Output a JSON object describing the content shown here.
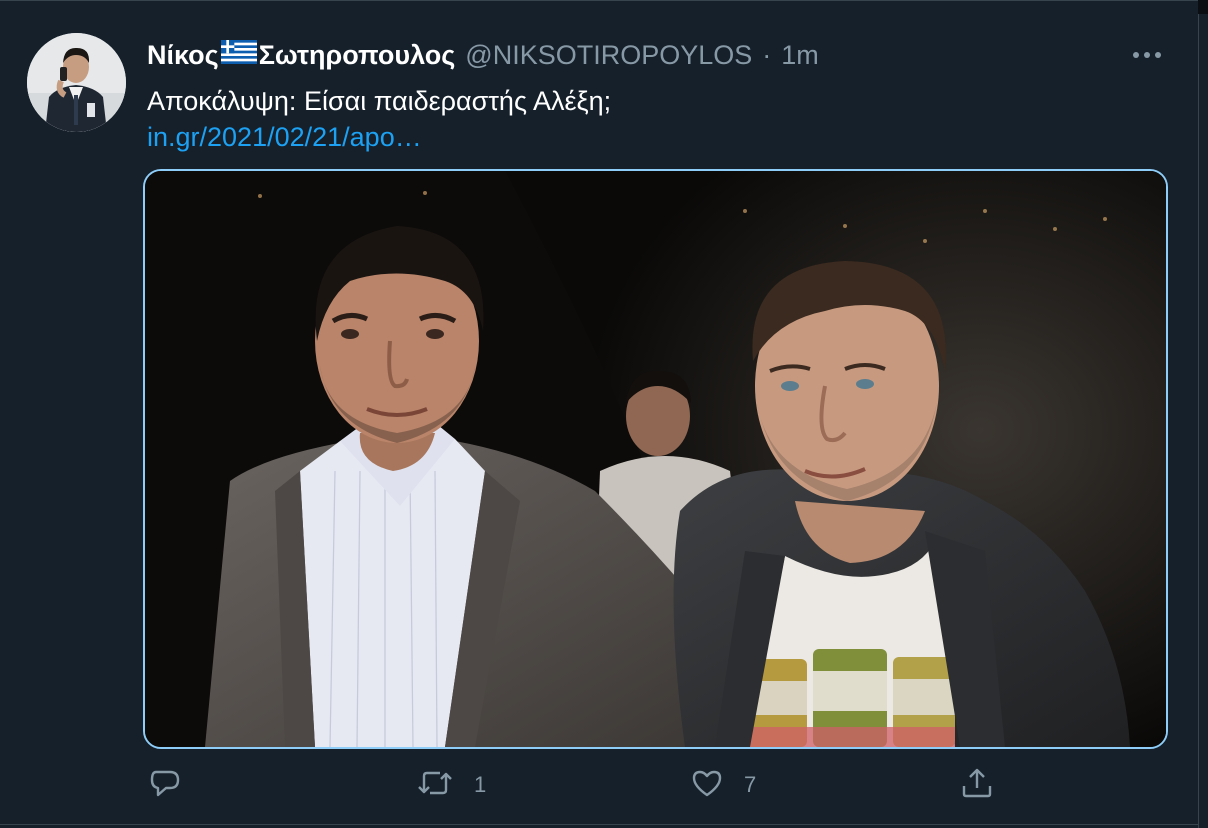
{
  "tweet": {
    "display_name_part1": "Νίκος",
    "display_name_part2": "Σωτηροπουλος",
    "flag_icon": "greek-flag-icon",
    "handle": "@NIKSOTIROPOYLOS",
    "separator": "·",
    "time": "1m",
    "text": "Αποκάλυψη: Είσαι παιδεραστής Αλέξη;",
    "link": "in.gr/2021/02/21/apo…"
  },
  "actions": {
    "reply_count": "",
    "retweet_count": "1",
    "like_count": "7"
  },
  "colors": {
    "background": "#15202b",
    "primary_text": "#ffffff",
    "secondary_text": "#8899a6",
    "link": "#1da1f2",
    "media_focus_border": "#8ecdf8"
  }
}
